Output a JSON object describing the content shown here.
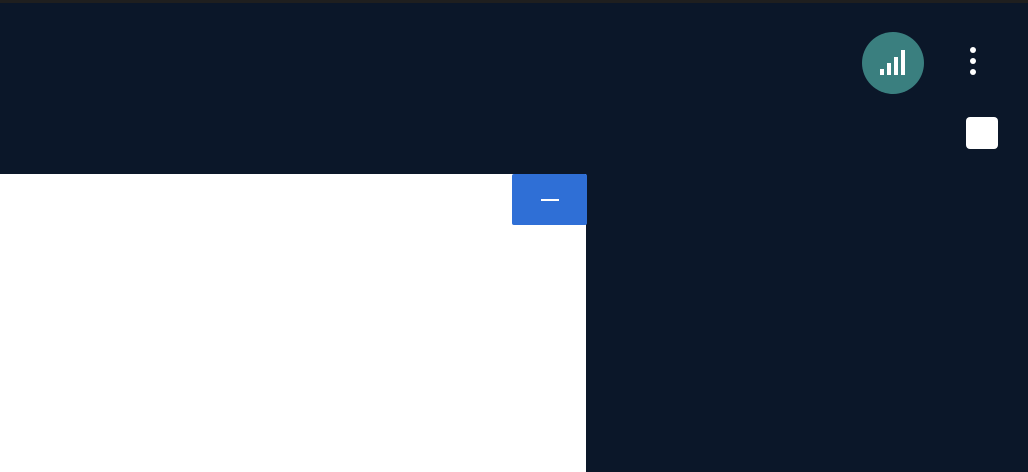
{
  "header": {
    "stats_icon": "signal-bars-icon",
    "more_icon": "more-vertical-icon",
    "stats_color": "#3a7f7f"
  },
  "panel": {
    "minimize_icon": "minimize-icon",
    "accent_color": "#2f6fd6"
  },
  "colors": {
    "background": "#0b1729",
    "panel": "#ffffff"
  }
}
